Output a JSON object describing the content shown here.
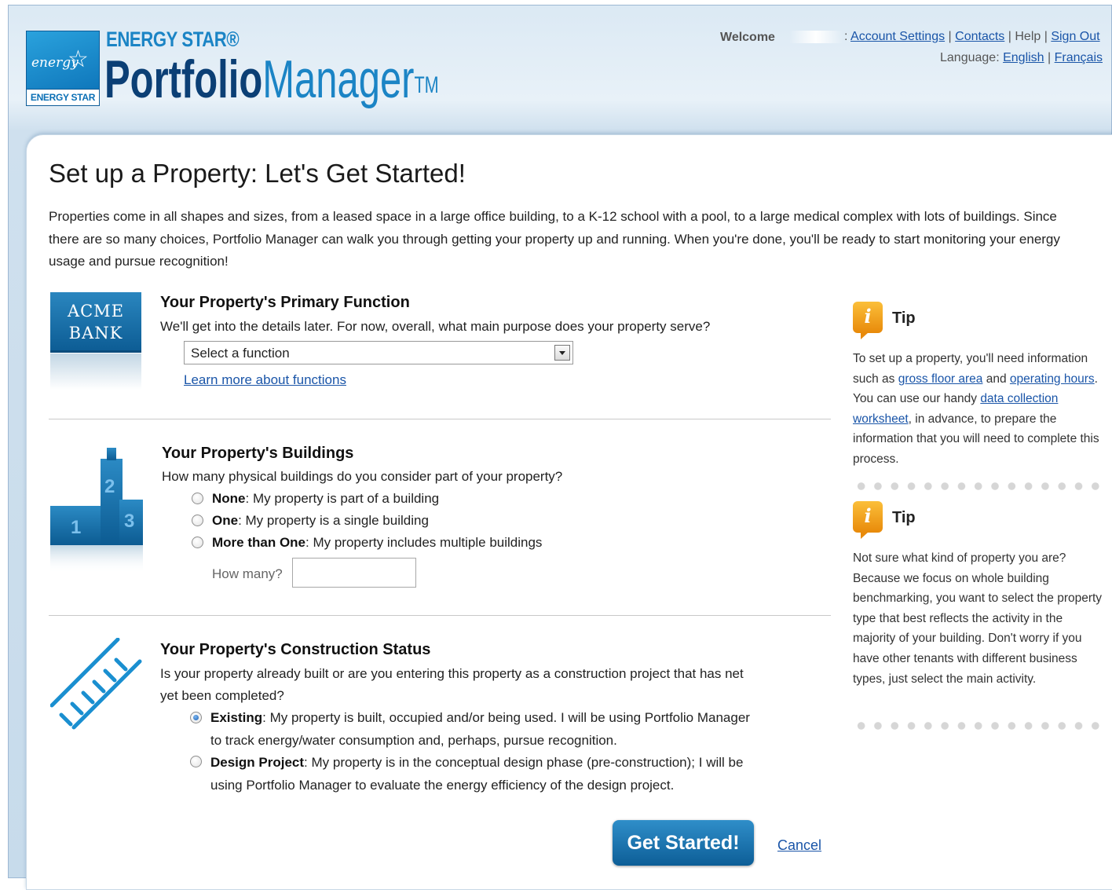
{
  "header": {
    "brand_small": "ENERGY STAR®",
    "brand_portfolio": "Portfolio",
    "brand_manager": "Manager",
    "brand_tm": "TM",
    "badge_script": "energy",
    "badge_bar": "ENERGY STAR",
    "welcome": "Welcome",
    "links": {
      "account_settings": "Account Settings",
      "contacts": "Contacts",
      "help": "Help",
      "sign_out": "Sign Out",
      "separator": "|",
      "colon": ":"
    },
    "language_label": "Language:",
    "language_english": "English",
    "language_french": "Français"
  },
  "page": {
    "title": "Set up a Property: Let's Get Started!",
    "intro": "Properties come in all shapes and sizes, from a leased space in a large office building, to a K-12 school with a pool, to a large medical complex with lots of buildings. Since there are so many choices, Portfolio Manager can walk you through getting your property up and running. When you're done, you'll be ready to start monitoring your energy usage and pursue recognition!"
  },
  "function_section": {
    "icon_text_1": "ACME",
    "icon_text_2": "BANK",
    "title": "Your Property's Primary Function",
    "question": "We'll get into the details later. For now, overall, what main purpose does your property serve?",
    "select_value": "Select a function",
    "learn_more": "Learn more about functions"
  },
  "buildings_section": {
    "title": "Your Property's Buildings",
    "question": "How many physical buildings do you consider part of your property?",
    "options": [
      {
        "label": "None",
        "desc": ": My property is part of a building",
        "selected": false
      },
      {
        "label": "One",
        "desc": ": My property is a single building",
        "selected": false
      },
      {
        "label": "More than One",
        "desc": ": My property includes multiple buildings",
        "selected": false
      }
    ],
    "how_many_label": "How many?",
    "how_many_value": "",
    "icon_numbers": [
      "1",
      "2",
      "3"
    ]
  },
  "construction_section": {
    "title": "Your Property's Construction Status",
    "question_line1": "Is your property already built or are you entering this property as a construction project that has net",
    "question_line2": "yet been completed?",
    "options": [
      {
        "label": "Existing",
        "line1": ": My property is built, occupied and/or being used. I will be using Portfolio Manager",
        "line2": "to track energy/water consumption and, perhaps, pursue recognition.",
        "selected": true
      },
      {
        "label": "Design Project",
        "line1": ": My property is in the conceptual design phase (pre-construction); I will be",
        "line2": "using Portfolio Manager to evaluate the energy efficiency of the design project.",
        "selected": false
      }
    ]
  },
  "actions": {
    "get_started": "Get Started!",
    "cancel": "Cancel"
  },
  "tips": [
    {
      "title": "Tip",
      "icon": "info-icon",
      "text_before_1": "To set up a property, you'll need information such as ",
      "link_1": "gross floor area",
      "text_between_1": " and ",
      "link_2": "operating hours",
      "text_between_2": ". You can use our handy ",
      "link_3": "data collection worksheet",
      "text_after": ", in advance, to prepare the information that you will need to complete this process."
    },
    {
      "title": "Tip",
      "icon": "info-icon",
      "text": "Not sure what kind of property you are? Because we focus on whole building benchmarking, you want to select the property type that best reflects the activity in the majority of your building. Don't worry if you have other tenants with different business types, just select the main activity."
    }
  ],
  "colors": {
    "brand_dark": "#0b3f75",
    "brand_light": "#1b84c5",
    "link": "#1a55a8",
    "button": "#0d5e97",
    "tip_orange": "#f0a020"
  }
}
